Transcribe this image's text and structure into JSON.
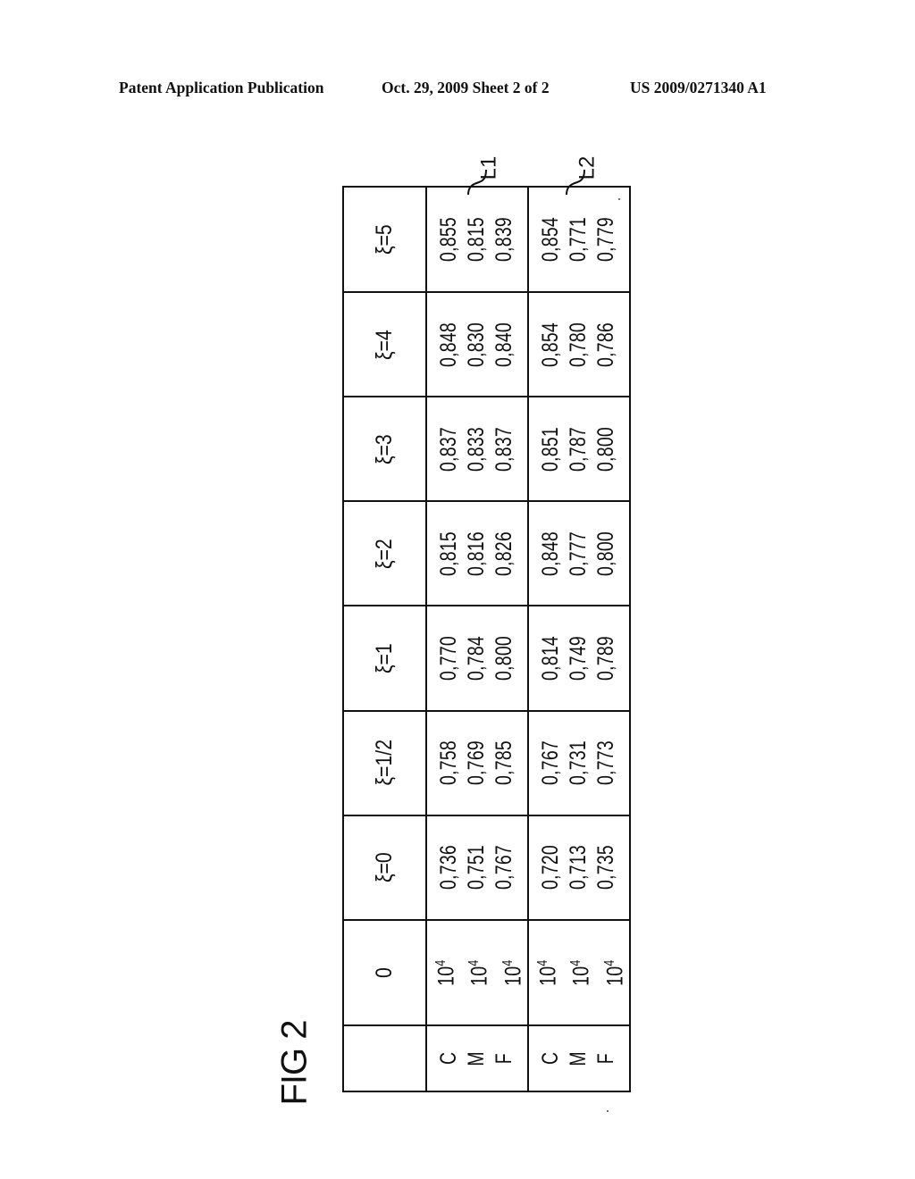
{
  "header": {
    "left": "Patent Application Publication",
    "middle": "Oct. 29, 2009   Sheet 2 of 2",
    "right": "US 2009/0271340 A1"
  },
  "figure": {
    "label": "FIG 2"
  },
  "table": {
    "header_row": [
      "",
      "0",
      "ξ=0",
      "ξ=1/2",
      "ξ=1",
      "ξ=2",
      "ξ=3",
      "ξ=4",
      "ξ=5"
    ],
    "groups": [
      {
        "lead_label": "L1",
        "rows": [
          {
            "label": "C",
            "zero": "10",
            "zero_exp": "4",
            "values": [
              "0,736",
              "0,758",
              "0,770",
              "0,815",
              "0,837",
              "0,848",
              "0,855"
            ]
          },
          {
            "label": "M",
            "zero": "10",
            "zero_exp": "4",
            "values": [
              "0,751",
              "0,769",
              "0,784",
              "0,816",
              "0,833",
              "0,830",
              "0,815"
            ]
          },
          {
            "label": "F",
            "zero": "10",
            "zero_exp": "4",
            "values": [
              "0,767",
              "0,785",
              "0,800",
              "0,826",
              "0,837",
              "0,840",
              "0,839"
            ]
          }
        ]
      },
      {
        "lead_label": "L2",
        "rows": [
          {
            "label": "C",
            "zero": "10",
            "zero_exp": "4",
            "values": [
              "0,720",
              "0,767",
              "0,814",
              "0,848",
              "0,851",
              "0,854",
              "0,854"
            ]
          },
          {
            "label": "M",
            "zero": "10",
            "zero_exp": "4",
            "values": [
              "0,713",
              "0,731",
              "0,749",
              "0,777",
              "0,787",
              "0,780",
              "0,771"
            ]
          },
          {
            "label": "F",
            "zero": "10",
            "zero_exp": "4",
            "values": [
              "0,735",
              "0,773",
              "0,789",
              "0,800",
              "0,800",
              "0,786",
              "0,779"
            ]
          }
        ]
      }
    ]
  }
}
